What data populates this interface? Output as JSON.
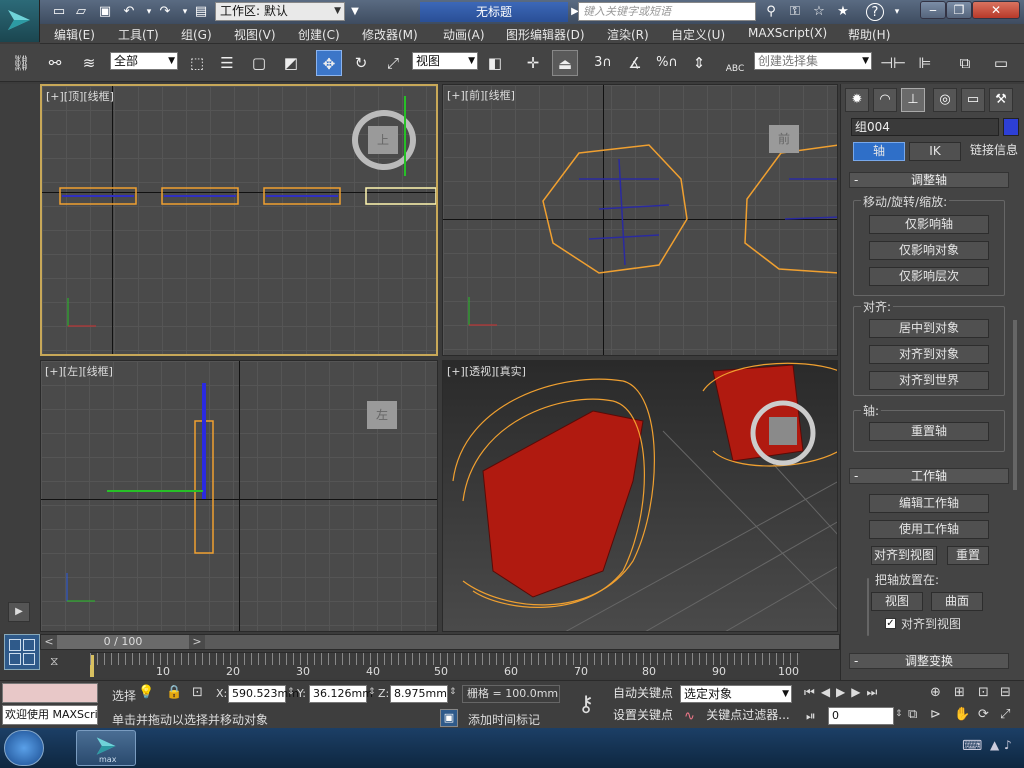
{
  "titlebar": {
    "workspace_label": "工作区: 默认",
    "document_title": "无标题",
    "search_placeholder": "键入关键字或短语",
    "help_glyph": "?"
  },
  "menu": [
    "编辑(E)",
    "工具(T)",
    "组(G)",
    "视图(V)",
    "创建(C)",
    "修改器(M)",
    "动画(A)",
    "图形编辑器(D)",
    "渲染(R)",
    "自定义(U)",
    "MAXScript(X)",
    "帮助(H)"
  ],
  "toolbar": {
    "filter_select": "全部",
    "ref_coord_select": "视图",
    "named_selection_placeholder": "创建选择集",
    "snap_3": "3",
    "snap_percent": "%",
    "abc_label": "ABC"
  },
  "viewports": {
    "top": {
      "label": "[+][顶][线框]",
      "cube": "上"
    },
    "front": {
      "label": "[+][前][线框]",
      "cube": "前"
    },
    "left": {
      "label": "[+][左][线框]",
      "cube": "左"
    },
    "perspective": {
      "label": "[+][透视][真实]"
    }
  },
  "panel": {
    "object_name": "组004",
    "object_color": "#2d3fd6",
    "tabs": {
      "pivot": "轴",
      "ik": "IK",
      "link_info": "链接信息"
    },
    "adjust_pivot": {
      "title": "调整轴",
      "move_group_label": "移动/旋转/缩放:",
      "affect_pivot": "仅影响轴",
      "affect_object": "仅影响对象",
      "affect_hierarchy": "仅影响层次",
      "align_group_label": "对齐:",
      "center_to_object": "居中到对象",
      "align_to_object": "对齐到对象",
      "align_to_world": "对齐到世界",
      "pivot_group_label": "轴:",
      "reset_pivot": "重置轴"
    },
    "working_pivot": {
      "title": "工作轴",
      "edit_working_pivot": "编辑工作轴",
      "use_working_pivot": "使用工作轴",
      "align_to_view": "对齐到视图",
      "reset": "重置",
      "place_pivot_label": "把轴放置在:",
      "view": "视图",
      "surface": "曲面",
      "align_to_view_check": "对齐到视图",
      "checked": true
    },
    "adjust_transform_title": "调整变换"
  },
  "timeline": {
    "frame_counter": "0 / 100",
    "ticks": [
      "10",
      "20",
      "30",
      "40",
      "50",
      "60",
      "70",
      "80",
      "90",
      "100"
    ]
  },
  "status": {
    "maxscript_welcome": "欢迎使用 MAXScri",
    "selection_label": "选择",
    "x_label": "X:",
    "x_value": "590.523mm",
    "y_label": "Y:",
    "y_value": "36.126mm",
    "z_label": "Z:",
    "z_value": "8.975mm",
    "grid_value": "栅格 = 100.0mm",
    "prompt": "单击并拖动以选择并移动对象",
    "add_time_tag": "添加时间标记",
    "auto_key": "自动关键点",
    "set_key": "设置关键点",
    "key_mode_select": "选定对象",
    "key_filters": "关键点过滤器...",
    "current_frame": "0"
  },
  "taskbar": {
    "app_label": "max"
  }
}
